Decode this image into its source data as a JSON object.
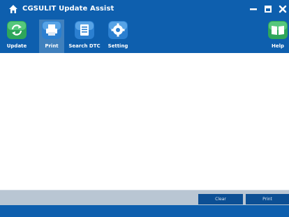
{
  "window": {
    "title": "CGSULIT Update Assist",
    "controls": {
      "minimize": "minimize-icon",
      "maximize": "maximize-icon",
      "close": "close-icon"
    }
  },
  "toolbar": {
    "items": [
      {
        "label": "Update",
        "icon": "update-icon"
      },
      {
        "label": "Print",
        "icon": "print-icon",
        "active": true
      },
      {
        "label": "Search DTC",
        "icon": "search-dtc-icon"
      },
      {
        "label": "Setting",
        "icon": "gear-icon"
      },
      {
        "label": "Help",
        "icon": "book-icon"
      }
    ]
  },
  "actions": {
    "clear_label": "Clear",
    "print_label": "Print"
  },
  "colors": {
    "brand": "#0e5fae",
    "active_tab": "#3f80bd",
    "button": "#0c4f94",
    "footer": "#b9c6d3"
  }
}
